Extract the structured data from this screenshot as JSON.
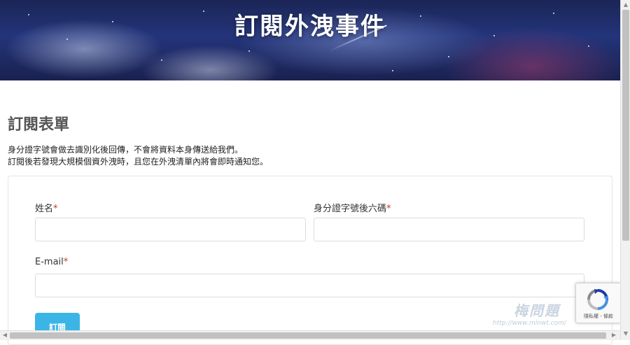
{
  "banner": {
    "title": "訂閱外洩事件"
  },
  "form_section": {
    "title": "訂閱表單",
    "description_line1": "身分證字號會做去識別化後回傳，不會將資料本身傳送給我們。",
    "description_line2": "訂閱後若發現大規模個資外洩時，且您在外洩清單內將會即時通知您。"
  },
  "form": {
    "name_label": "姓名",
    "id_label": "身分證字號後六碼",
    "email_label": "E-mail",
    "required_mark": "*",
    "name_value": "",
    "id_value": "",
    "email_value": "",
    "submit_label": "訂閱"
  },
  "recaptcha": {
    "privacy_text": "隱私權 - 條款"
  },
  "watermark": {
    "url": "http://www.minwt.com/"
  },
  "colors": {
    "accent": "#3bb5e6",
    "required": "#c0392b",
    "banner_dark": "#1b2556"
  }
}
